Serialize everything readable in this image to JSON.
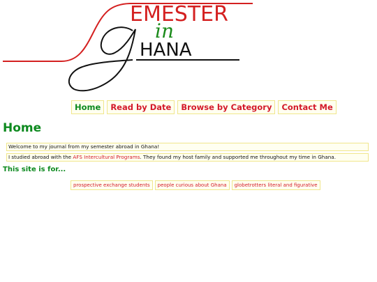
{
  "logo": {
    "line1": "EMESTER",
    "line2": "in",
    "line3": "HANA"
  },
  "nav": [
    {
      "label": "Home",
      "active": true
    },
    {
      "label": "Read by Date",
      "active": false
    },
    {
      "label": "Browse by Category",
      "active": false
    },
    {
      "label": "Contact Me",
      "active": false
    }
  ],
  "page_title": "Home",
  "intro": {
    "welcome": "Welcome to my journal from my semester abroad in Ghana!",
    "studied_prefix": "I studied abroad with the ",
    "studied_link": "AFS Intercultural Programs",
    "studied_suffix": ". They found my host family and supported me throughout my time in Ghana."
  },
  "audience": {
    "title": "This site is for...",
    "tags": [
      "prospective exchange students",
      "people curious about Ghana",
      "globetrotters literal and figurative"
    ]
  },
  "colors": {
    "red": "#d41a2a",
    "green": "#0d8a1f",
    "panel_border": "#f0e68c",
    "panel_bg": "#fffff0"
  }
}
